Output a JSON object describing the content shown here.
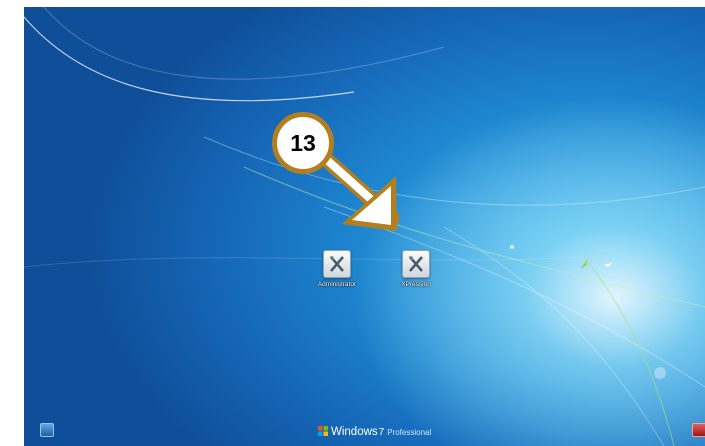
{
  "desktop": {
    "icons": [
      {
        "label": "Administrator",
        "icon": "x-tool-icon"
      },
      {
        "label": "XPression",
        "icon": "x-tool-icon"
      }
    ]
  },
  "callout": {
    "number": "13"
  },
  "branding": {
    "name": "Windows",
    "version": "7",
    "edition": "Professional"
  },
  "colors": {
    "callout_border": "#b37f1e",
    "desktop_blue": "#1e86d0",
    "power": "#c02828"
  }
}
